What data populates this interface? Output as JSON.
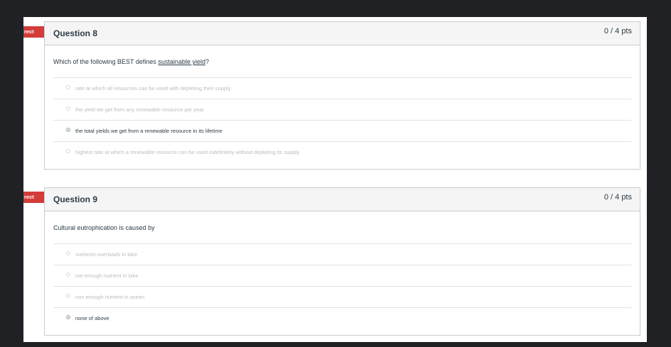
{
  "questions": [
    {
      "flag": "rect",
      "title": "Question 8",
      "points": "0 / 4 pts",
      "text_before": "Which of the following BEST defines ",
      "text_underline": "sustainable yield",
      "text_after": "?",
      "answers": [
        {
          "label": "rate at which all resources can be used with depleting their supply",
          "selected": false
        },
        {
          "label": "the yield we get from any renewable resource per year",
          "selected": false
        },
        {
          "label": "the total yields we get from a renewable resource in its lifetime",
          "selected": true
        },
        {
          "label": "highest rate at which a renewable resource can be used indefinitely without depleting its supply",
          "selected": false
        }
      ]
    },
    {
      "flag": "rect",
      "title": "Question 9",
      "points": "0 / 4 pts",
      "text": "Cultural eutrophication is caused by",
      "answers": [
        {
          "label": "nutrients overloads in lake",
          "selected": false
        },
        {
          "label": "not enough nutrient in lake",
          "selected": false
        },
        {
          "label": "non enough nutrient in ocean",
          "selected": false
        },
        {
          "label": "none of above",
          "selected": true
        }
      ]
    }
  ],
  "colors": {
    "flag": "#d23b38",
    "background": "#202124",
    "text": "#2d3b45"
  }
}
